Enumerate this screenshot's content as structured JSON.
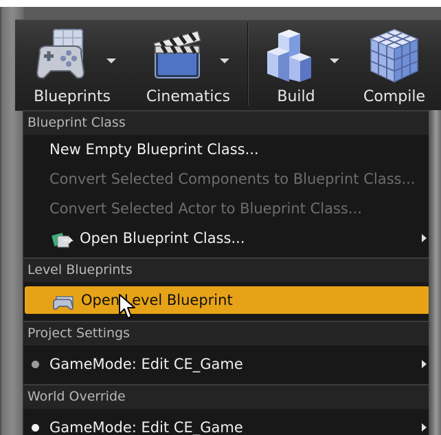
{
  "toolbar": {
    "buttons": [
      {
        "label": "Blueprints",
        "icon": "gamepad-icon",
        "has_dropdown": true
      },
      {
        "label": "Cinematics",
        "icon": "clapperboard-icon",
        "has_dropdown": true
      },
      {
        "label": "Build",
        "icon": "build-blocks-icon",
        "has_dropdown": true
      },
      {
        "label": "Compile",
        "icon": "compile-cube-icon",
        "has_dropdown": false
      }
    ]
  },
  "menu": {
    "sections": [
      {
        "header": "Blueprint Class",
        "items": [
          {
            "label": "New Empty Blueprint Class...",
            "enabled": true
          },
          {
            "label": "Convert Selected Components to Blueprint Class...",
            "enabled": false
          },
          {
            "label": "Convert Selected Actor to Blueprint Class...",
            "enabled": false
          },
          {
            "label": "Open Blueprint Class...",
            "enabled": true,
            "icon": "open-blueprint-icon",
            "submenu": true
          }
        ]
      },
      {
        "header": "Level Blueprints",
        "items": [
          {
            "label": "Open Level Blueprint",
            "enabled": true,
            "icon": "level-blueprint-icon",
            "highlighted": true
          }
        ]
      },
      {
        "header": "Project Settings",
        "items": [
          {
            "label": "GameMode: Edit CE_Game",
            "enabled": true,
            "bullet": "dim",
            "submenu": true
          }
        ]
      },
      {
        "header": "World Override",
        "items": [
          {
            "label": "GameMode: Edit CE_Game",
            "enabled": true,
            "bullet": "bright",
            "submenu": true
          }
        ]
      }
    ]
  },
  "colors": {
    "highlight": "#e7a317",
    "menu_background": "#181818",
    "toolbar_background": "#2b2b2b",
    "disabled_text": "#6e6e6e"
  }
}
